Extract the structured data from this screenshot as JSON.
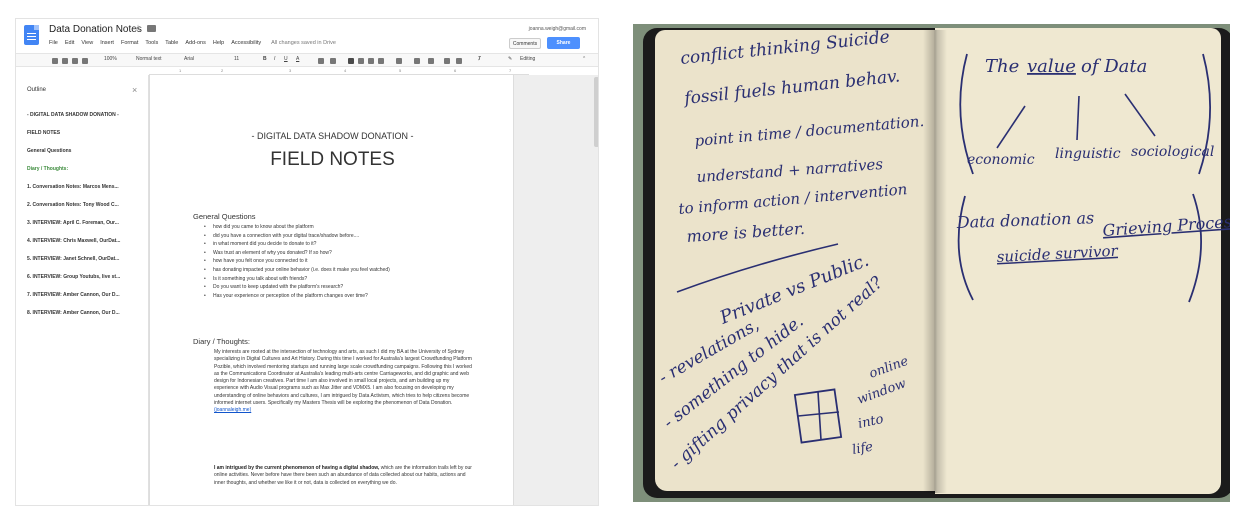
{
  "gdocs": {
    "doc_title": "Data Donation Notes",
    "menu": [
      "File",
      "Edit",
      "View",
      "Insert",
      "Format",
      "Tools",
      "Table",
      "Add-ons",
      "Help",
      "Accessibility"
    ],
    "save_status": "All changes saved in Drive",
    "user_email": "joanna.weigh@gmail.com",
    "comments_label": "Comments",
    "share_label": "Share",
    "toolbar": {
      "zoom": "100%",
      "style": "Normal text",
      "font": "Arial",
      "size": "11",
      "mode": "Editing"
    },
    "ruler_ticks": [
      "1",
      "2",
      "3",
      "4",
      "5",
      "6",
      "7"
    ],
    "outline": {
      "title": "Outline",
      "items": [
        "- DIGITAL DATA SHADOW DONATION -",
        "FIELD NOTES",
        "General Questions",
        "Diary / Thoughts:",
        "1. Conversation Notes: Marcos Mens...",
        "2. Conversation Notes: Tony Wood C...",
        "3. INTERVIEW: April C. Foreman, Our...",
        "4. INTERVIEW: Chris Maxwell, OurDat...",
        "5. INTERVIEW: Janet Schnell, OurDat...",
        "6. INTERVIEW: Group Youtubs, live st...",
        "7. INTERVIEW: Amber Cannon, Our D...",
        "8. INTERVIEW: Amber Cannon, Our D..."
      ]
    },
    "document": {
      "kicker": "- DIGITAL DATA SHADOW DONATION -",
      "heading": "FIELD NOTES",
      "general_questions_heading": "General Questions",
      "questions": [
        "how did you came to know about the platform",
        "did you have a connection with your digital trace/shadow before....",
        "in what moment did you decide to donate to it?",
        "Was trust an element of why you donated? If so how?",
        "how have you felt once you connected to it",
        "has donating impacted your online behavior (i.e. does it make you feel watched)",
        "Is it something you talk about with friends?",
        "Do you want to keep updated with the platform's research?",
        "Has your experience or perception of the platform changes over time?"
      ],
      "diary_heading": "Diary / Thoughts:",
      "diary_para_1": "My interests are rooted at the intersection of technology and arts, as such I did my BA at the University of Sydney specializing in Digital Cultures and Art History. During this time I worked for Australia's largest Crowdfunding Platform Pozible, which involved mentoring startups and running large scale crowdfunding campaigns. Following this I worked as the Communications Coordinator at Australia's leading multi-arts centre Carriageworks, and did graphic and web design for Indonesian creatives. Part time I am also involved in small local projects, and am building up my experience with Audio Visual programs such as Max Jitter and VDMX5. I am also focusing on developing my understanding of online behaviors and cultures, I am intrigued by Data Activism, which tries to help citizens become informed internet users. Specifically my Masters Thesis will be exploring the phenomenon of Data Donation.",
      "diary_link": "(joannaleigh.me)",
      "diary_para_2_bold": "I am intrigued by the current phenomenon of having a digital shadow,",
      "diary_para_2_rest": " which are the information trails left by our online activities. Never before have there been such an abundance of data collected about our habits, actions and inner thoughts, and whether we like it or not, data is collected on everything we do."
    }
  },
  "notebook": {
    "left_page_lines": [
      "conflict thinking Suicide",
      "fossil fuels human behav.",
      "point in time / documentation.",
      "understand + narratives",
      "to inform action / intervention",
      "more is better.",
      "Private vs Public.",
      "- revelations,",
      "- something to hide.",
      "- gifting privacy that is not real?",
      "online",
      "window",
      "into",
      "life"
    ],
    "right_page_lines": {
      "title_prefix": "The",
      "title_value": "value",
      "title_suffix": "of Data",
      "branches": [
        "economic",
        "linguistic",
        "sociological"
      ],
      "donation_1": "Data donation as",
      "donation_2": "Grieving Process.",
      "donation_3": "suicide survivor"
    },
    "ink_color": "#2a2f72"
  }
}
